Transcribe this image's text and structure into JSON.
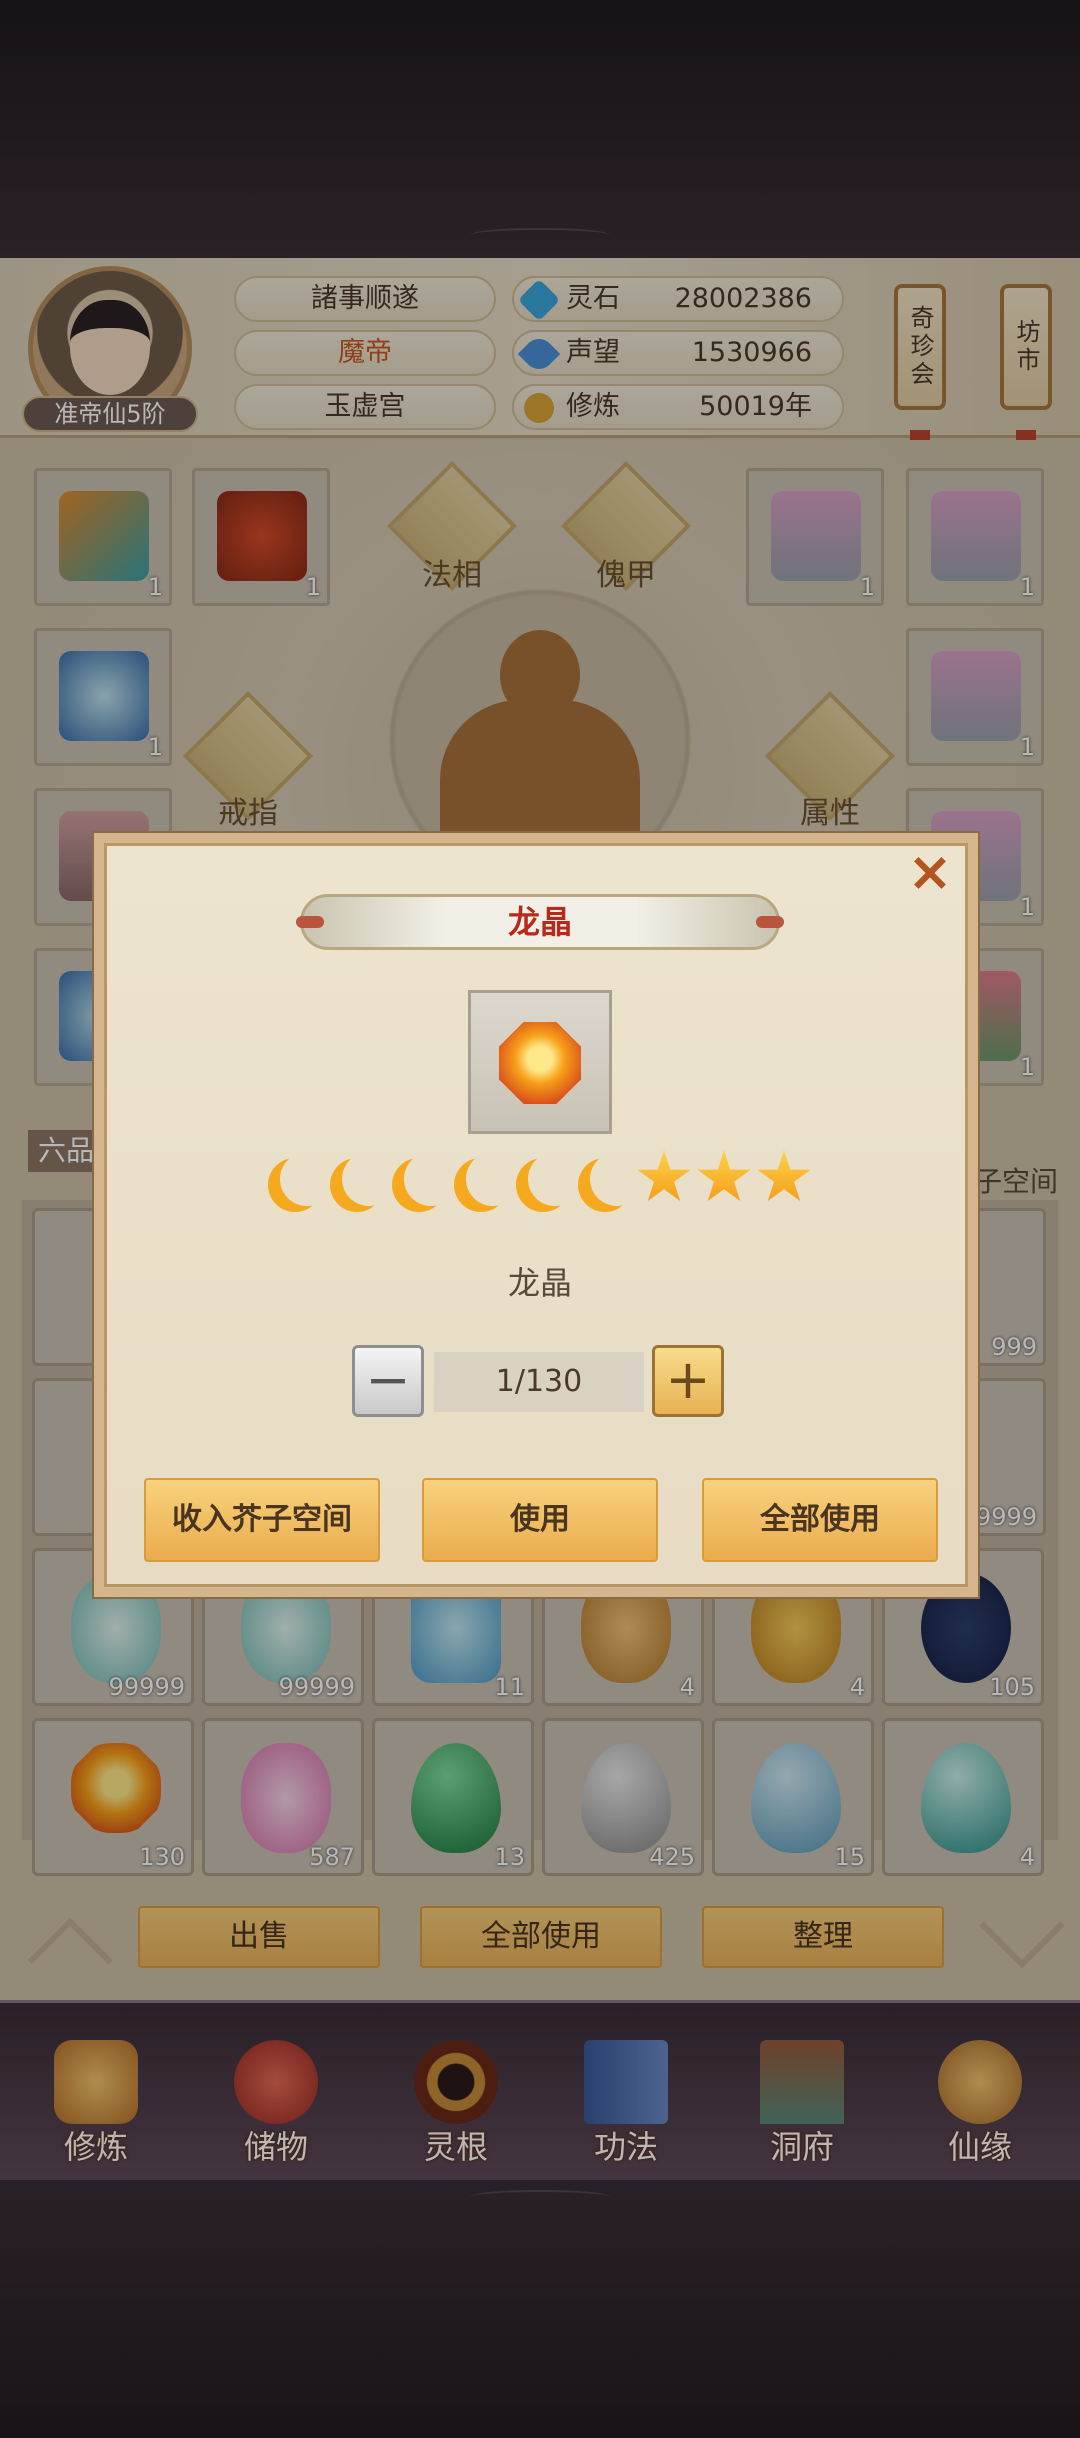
{
  "player": {
    "rank": "准帝仙5阶",
    "title_1": "諸事顺遂",
    "title_2": "魔帝",
    "title_3": "玉虚宫"
  },
  "stats": [
    {
      "label": "灵石",
      "value": "28002386",
      "icon": "spirit-stone-icon",
      "color": "#3aa6d8"
    },
    {
      "label": "声望",
      "value": "1530966",
      "icon": "prestige-icon",
      "color": "#4b8fd6"
    },
    {
      "label": "修炼",
      "value": "50019年",
      "icon": "cultivation-icon",
      "color": "#d9a23a"
    }
  ],
  "side_buttons": {
    "treasure": "奇珍会",
    "market": "坊市"
  },
  "equipment": {
    "diamond_1": "法相",
    "diamond_2": "傀甲",
    "diamond_3": "戒指",
    "diamond_4": "属性",
    "slot_counts": [
      "1",
      "1",
      "1",
      "1",
      "1",
      "1",
      "1",
      "1",
      "1"
    ]
  },
  "inventory": {
    "tab": "六品",
    "space_label": "芥子空间",
    "row3_counts": [
      "99999",
      "99999",
      "11",
      "4",
      "4",
      "105"
    ],
    "row4_counts": [
      "130",
      "587",
      "13",
      "425",
      "15",
      "4"
    ],
    "side_counts": [
      "999",
      "9999"
    ]
  },
  "action_bar": {
    "sell": "出售",
    "use_all": "全部使用",
    "arrange": "整理"
  },
  "nav": [
    {
      "label": "修炼",
      "icon": "cultivate-nav-icon"
    },
    {
      "label": "储物",
      "icon": "storage-bag-icon"
    },
    {
      "label": "灵根",
      "icon": "spirit-root-icon"
    },
    {
      "label": "功法",
      "icon": "technique-book-icon"
    },
    {
      "label": "洞府",
      "icon": "cave-mansion-icon"
    },
    {
      "label": "仙缘",
      "icon": "immortal-fate-icon"
    }
  ],
  "dialog": {
    "title": "龙晶",
    "item_name": "龙晶",
    "quantity": "1/130",
    "moons": 6,
    "stars": 3,
    "btn_store": "收入芥子空间",
    "btn_use": "使用",
    "btn_use_all": "全部使用"
  }
}
